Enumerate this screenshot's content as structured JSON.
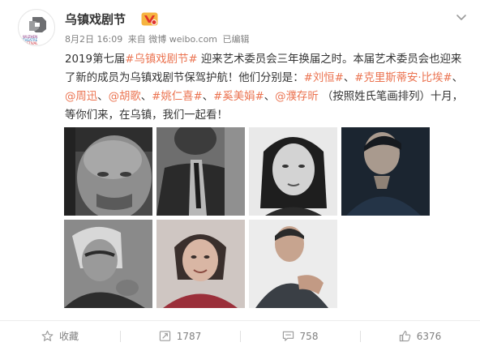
{
  "post": {
    "author": "乌镇戏剧节",
    "time": "8月2日 16:09",
    "source": "来自 微博 weibo.com",
    "edited": "已编辑",
    "avatar_logo_text": "WUZHEN THEATRE FESTIVAL",
    "icons": {
      "badge": "vip-badge-icon",
      "more": "chevron-down-icon"
    },
    "text": {
      "p1": "2019第七届",
      "tag_festival": "#乌镇戏剧节#",
      "p2": " 迎来艺术委员会三年换届之时。本届艺术委员会也迎来了新的成员为乌镇戏剧节保驾护航！他们分别是：",
      "tag_liu": "#刘恒#",
      "sep1": "、",
      "tag_krzysztof": "#克里斯蒂安·比埃#",
      "sep2": "、",
      "mention_zhou": "@周迅",
      "sep3": "、",
      "mention_hu": "@胡歌",
      "sep4": "、",
      "tag_yao": "#姚仁喜#",
      "sep5": "、",
      "tag_xi": "#奚美娟#",
      "sep6": "、",
      "mention_pu": "@濮存昕",
      "p3": " （按照姓氏笔画排列）十月，等你们来，在乌镇，我们一起看！"
    }
  },
  "photos": [
    {
      "name": "photo-liu-heng"
    },
    {
      "name": "photo-krzysztof"
    },
    {
      "name": "photo-zhou-xun"
    },
    {
      "name": "photo-hu-ge"
    },
    {
      "name": "photo-yao-renxi"
    },
    {
      "name": "photo-xi-meijuan"
    },
    {
      "name": "photo-pu-cunxin"
    }
  ],
  "footer": {
    "favorite_label": "收藏",
    "repost_count": "1787",
    "comment_count": "758",
    "like_count": "6376"
  },
  "colors": {
    "link": "#eb7350",
    "text": "#333333",
    "meta": "#808080"
  }
}
